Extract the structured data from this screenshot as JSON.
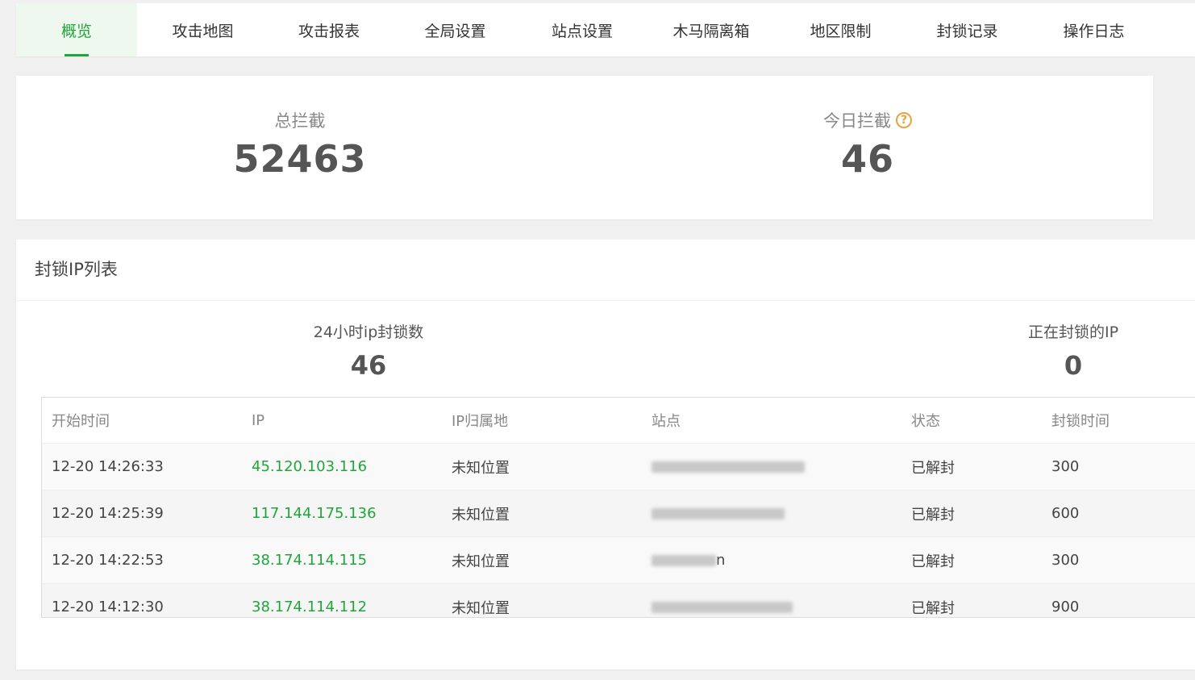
{
  "tabs": [
    {
      "label": "概览",
      "active": true
    },
    {
      "label": "攻击地图"
    },
    {
      "label": "攻击报表"
    },
    {
      "label": "全局设置"
    },
    {
      "label": "站点设置"
    },
    {
      "label": "木马隔离箱"
    },
    {
      "label": "地区限制"
    },
    {
      "label": "封锁记录"
    },
    {
      "label": "操作日志"
    }
  ],
  "stats": {
    "total_label": "总拦截",
    "total_value": "52463",
    "today_label": "今日拦截",
    "today_value": "46"
  },
  "panel": {
    "title": "封锁IP列表",
    "blocked_24h_label": "24小时ip封锁数",
    "blocked_24h_value": "46",
    "blocking_now_label": "正在封锁的IP",
    "blocking_now_value": "0"
  },
  "table": {
    "headers": [
      "开始时间",
      "IP",
      "IP归属地",
      "站点",
      "状态",
      "封锁时间"
    ],
    "rows": [
      {
        "time": "12-20 14:26:33",
        "ip": "45.120.103.116",
        "location": "未知位置",
        "site": "",
        "status": "已解封",
        "duration": "300"
      },
      {
        "time": "12-20 14:25:39",
        "ip": "117.144.175.136",
        "location": "未知位置",
        "site": "",
        "status": "已解封",
        "duration": "600"
      },
      {
        "time": "12-20 14:22:53",
        "ip": "38.174.114.115",
        "location": "未知位置",
        "site": "n",
        "status": "已解封",
        "duration": "300"
      },
      {
        "time": "12-20 14:12:30",
        "ip": "38.174.114.112",
        "location": "未知位置",
        "site": "",
        "status": "已解封",
        "duration": "900"
      }
    ]
  },
  "colors": {
    "accent": "#20a53a",
    "help": "#e8a33b"
  }
}
